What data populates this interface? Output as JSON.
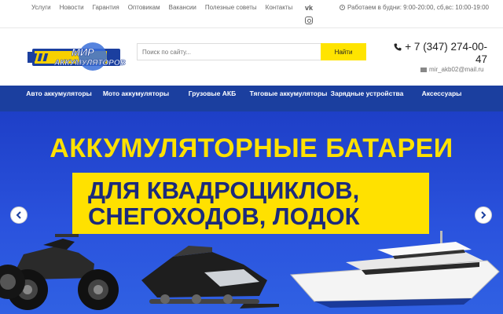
{
  "topbar": {
    "links": [
      "Услуги",
      "Новости",
      "Гарантия",
      "Оптовикам",
      "Вакансии",
      "Полезные советы",
      "Контакты"
    ],
    "vk_label": "vk",
    "instagram_icon": "instagram-icon",
    "hours": "Работаем в будни: 9:00-20:00, сб,вс: 10:00-19:00"
  },
  "header": {
    "logo_line1": "МИР",
    "logo_line2": "АККУМУЛЯТОРОВ",
    "search_placeholder": "Поиск по сайту...",
    "search_button": "Найти",
    "phone_line1": "+ 7 (347) 274-00-",
    "phone_line2": "47",
    "email": "mir_akb02@mail.ru"
  },
  "nav": {
    "items": [
      {
        "label": "Авто аккумуляторы"
      },
      {
        "label": "Мото аккумуляторы"
      },
      {
        "label": "Грузовые АКБ"
      },
      {
        "label": "Тяговые аккумуляторы"
      },
      {
        "label": "Зарядные устройства"
      },
      {
        "label": "Аксессуары"
      }
    ]
  },
  "banner": {
    "title": "АККУМУЛЯТОРНЫЕ БАТАРЕИ",
    "subtitle_line1": "ДЛЯ КВАДРОЦИКЛОВ,",
    "subtitle_line2": "СНЕГОХОДОВ, ЛОДОК"
  },
  "colors": {
    "nav_bg": "#1b3f9f",
    "banner_bg": "#2a52dd",
    "accent_yellow": "#ffe100",
    "subtitle_text": "#1b2a7c"
  }
}
